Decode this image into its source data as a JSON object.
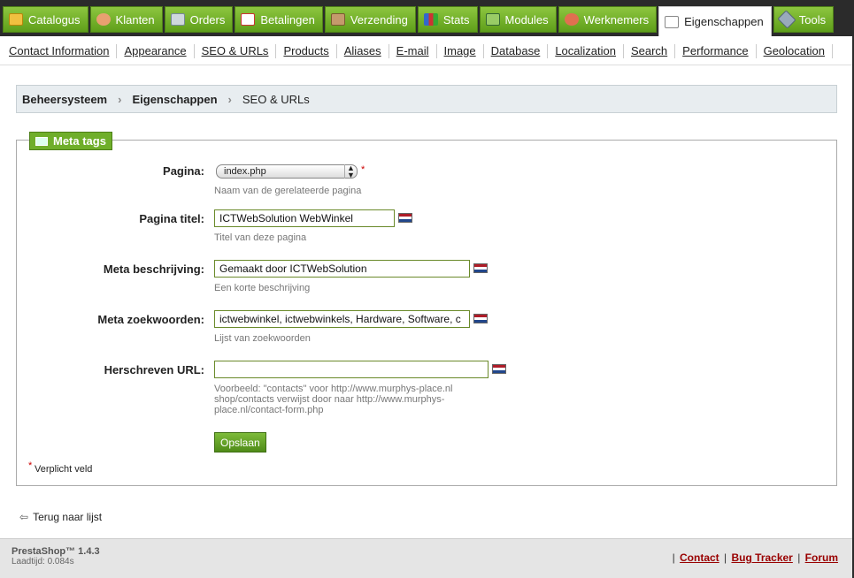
{
  "top_tabs": [
    {
      "label": "Catalogus"
    },
    {
      "label": "Klanten"
    },
    {
      "label": "Orders"
    },
    {
      "label": "Betalingen"
    },
    {
      "label": "Verzending"
    },
    {
      "label": "Stats"
    },
    {
      "label": "Modules"
    },
    {
      "label": "Werknemers"
    },
    {
      "label": "Eigenschappen"
    },
    {
      "label": "Tools"
    }
  ],
  "sub_nav": [
    "Contact Information",
    "Appearance",
    "SEO & URLs",
    "Products",
    "Aliases",
    "E-mail",
    "Image",
    "Database",
    "Localization",
    "Search",
    "Performance",
    "Geolocation"
  ],
  "breadcrumb": [
    "Beheersysteem",
    "Eigenschappen",
    "SEO & URLs"
  ],
  "form": {
    "legend": "Meta tags",
    "pagina": {
      "label": "Pagina:",
      "value": "index.php",
      "hint": "Naam van de gerelateerde pagina"
    },
    "titel": {
      "label": "Pagina titel:",
      "value": "ICTWebSolution WebWinkel",
      "hint": "Titel van deze pagina"
    },
    "beschrijving": {
      "label": "Meta beschrijving:",
      "value": "Gemaakt door ICTWebSolution",
      "hint": "Een korte beschrijving"
    },
    "zoekwoorden": {
      "label": "Meta zoekwoorden:",
      "value": "ictwebwinkel, ictwebwinkels, Hardware, Software, c",
      "hint": "Lijst van zoekwoorden"
    },
    "url": {
      "label": "Herschreven URL:",
      "value": "",
      "hint1": "Voorbeeld: \"contacts\" voor http://www.murphys-place.nl",
      "hint2": "shop/contacts verwijst door naar http://www.murphys-",
      "hint3": "place.nl/contact-form.php"
    },
    "save": "Opslaan",
    "required_star": "*",
    "required_note": "Verplicht veld"
  },
  "back_link": "Terug naar lijst",
  "footer": {
    "version": "PrestaShop™ 1.4.3",
    "load_time": "Laadtijd: 0.084s",
    "links": [
      "Contact",
      "Bug Tracker",
      "Forum"
    ]
  }
}
